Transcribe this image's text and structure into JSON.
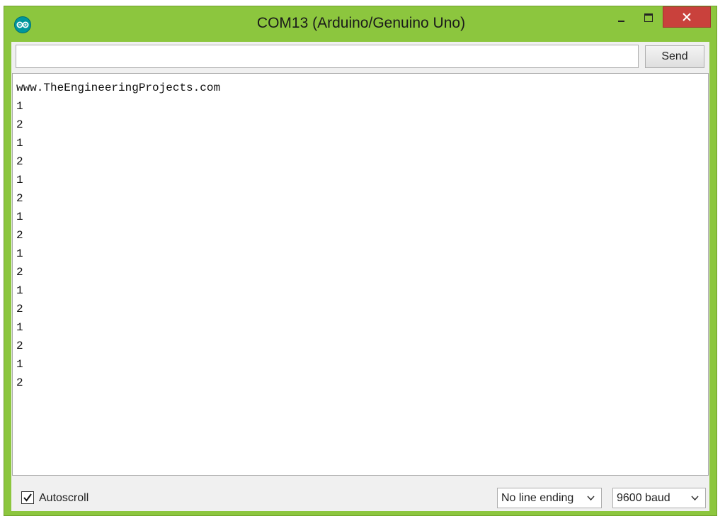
{
  "window": {
    "title": "COM13 (Arduino/Genuino Uno)",
    "icon": "arduino-logo-icon",
    "accent_color": "#8cc63e",
    "close_color": "#c9413c"
  },
  "input": {
    "value": "",
    "placeholder": ""
  },
  "send_label": "Send",
  "output_lines": [
    "www.TheEngineeringProjects.com",
    "1",
    "2",
    "1",
    "2",
    "1",
    "2",
    "1",
    "2",
    "1",
    "2",
    "1",
    "2",
    "1",
    "2",
    "1",
    "2"
  ],
  "autoscroll": {
    "label": "Autoscroll",
    "checked": true
  },
  "line_ending": {
    "selected": "No line ending"
  },
  "baud": {
    "selected": "9600 baud"
  }
}
